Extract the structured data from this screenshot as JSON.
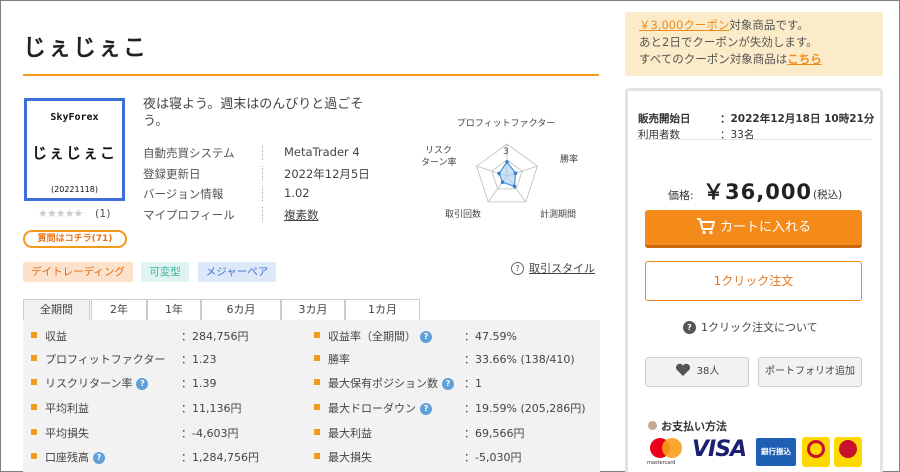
{
  "product": {
    "title": "じぇじぇこ",
    "image_brand": "SkyForex",
    "image_name": "じぇじぇこ",
    "image_code": "(20221118)",
    "stars": "★★★★★",
    "rating_count": "(1)",
    "question_button": "質問はコチラ(71)",
    "catchphrase": "夜は寝よう。週末はのんびりと過ごそう。"
  },
  "info": [
    {
      "label": "自動売買システム",
      "value": "MetaTrader 4"
    },
    {
      "label": "登録更新日",
      "value": "2022年12月5日"
    },
    {
      "label": "バージョン情報",
      "value": "1.02"
    },
    {
      "label": "マイプロフィール",
      "value": "複素数"
    }
  ],
  "radar": {
    "labels": {
      "pf": "プロフィットファクター",
      "win": "勝率",
      "period": "計測期間",
      "trades": "取引回数",
      "rr1": "リスク",
      "rr2": "ターン率"
    },
    "tick": "3",
    "values": {
      "pf": 2.2,
      "win": 1.4,
      "period": 2.0,
      "trades": 1.2,
      "rr": 1.3
    },
    "max": 5
  },
  "tags": [
    "デイトレーディング",
    "可変型",
    "メジャーペア"
  ],
  "style_link": "取引スタイル",
  "tabs": [
    "全期間",
    "2年",
    "1年",
    "6カ月",
    "3カ月",
    "1カ月"
  ],
  "stats_left": [
    {
      "label": "収益",
      "value": "：284,756円",
      "help": false
    },
    {
      "label": "プロフィットファクター",
      "value": "：1.23",
      "help": false
    },
    {
      "label": "リスクリターン率",
      "value": "：1.39",
      "help": true
    },
    {
      "label": "平均利益",
      "value": "：11,136円",
      "help": false
    },
    {
      "label": "平均損失",
      "value": "：-4,603円",
      "help": false
    },
    {
      "label": "口座残高",
      "value": "：1,284,756円",
      "help": true
    }
  ],
  "stats_right": [
    {
      "label": "収益率（全期間）",
      "value": "：47.59%",
      "help": true
    },
    {
      "label": "勝率",
      "value": "：33.66% (138/410)",
      "help": false
    },
    {
      "label": "最大保有ポジション数",
      "value": "：1",
      "help": true
    },
    {
      "label": "最大ドローダウン",
      "value": "：19.59% (205,286円)",
      "help": true
    },
    {
      "label": "最大利益",
      "value": "：69,566円",
      "help": false
    },
    {
      "label": "最大損失",
      "value": "：-5,030円",
      "help": false
    }
  ],
  "coupon": {
    "amount": "￥3,000クーポン",
    "line1_rest": "対象商品です。",
    "line2": "あと2日でクーポンが失効します。",
    "line3_pre": "すべてのクーポン対象商品は",
    "line3_link": "こちら"
  },
  "sale": {
    "start_label": "販売開始日",
    "start_value": "：2022年12月18日 10時21分",
    "users_label": "利用者数",
    "users_value": "：33名",
    "price_label": "価格:",
    "price": "￥36,000",
    "tax": "(税込)",
    "cart_button": "カートに入れる",
    "oneclick_button": "1クリック注文",
    "oneclick_help": "1クリック注文について",
    "fav_count": "38人",
    "portfolio_button": "ポートフォリオ追加",
    "payment_title": "お支払い方法",
    "mastercard": "mastercard",
    "visa": "VISA",
    "bank": "銀行振込"
  }
}
